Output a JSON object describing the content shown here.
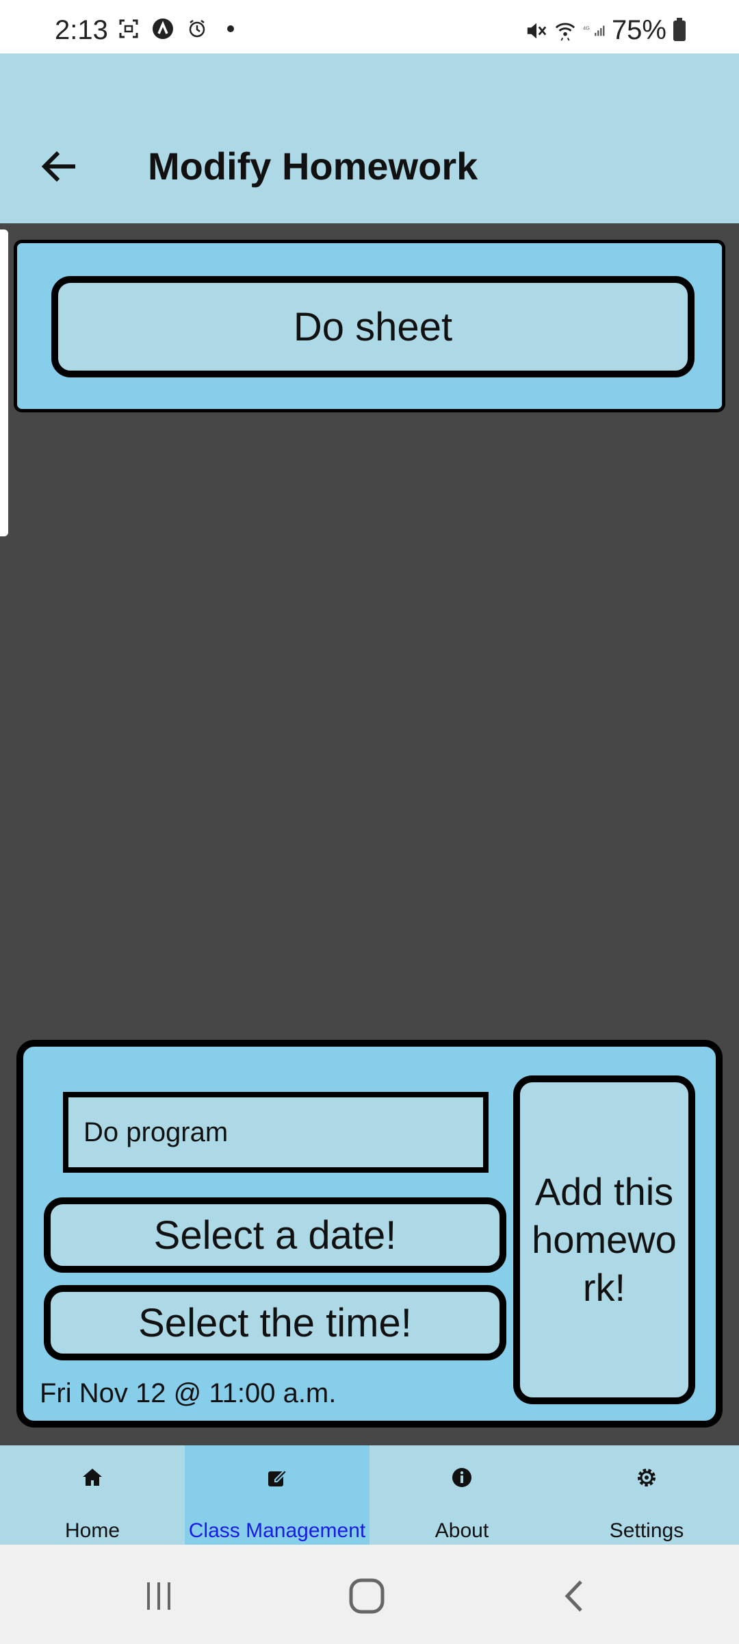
{
  "status_bar": {
    "time": "2:13",
    "battery": "75%",
    "icons": [
      "screenshot-icon",
      "app-notification-icon",
      "alarm-icon",
      "mute-icon",
      "wifi-icon",
      "4g-signal-icon",
      "battery-icon"
    ]
  },
  "header": {
    "title": "Modify Homework",
    "back_icon": "arrow-left-icon"
  },
  "homework_list": {
    "items": [
      {
        "label": "Do sheet"
      }
    ]
  },
  "form": {
    "input_value": "Do program",
    "select_date_label": "Select a date!",
    "select_time_label": "Select the time!",
    "selected_datetime": "Fri Nov 12 @ 11:00 a.m.",
    "add_button_label": "Add this homework!"
  },
  "tabs": [
    {
      "label": "Home",
      "icon": "home-icon",
      "active": false
    },
    {
      "label": "Class Management",
      "icon": "edit-icon",
      "active": true
    },
    {
      "label": "About",
      "icon": "info-icon",
      "active": false
    },
    {
      "label": "Settings",
      "icon": "gear-icon",
      "active": false
    }
  ],
  "colors": {
    "header_bg": "#add8e6",
    "card_bg": "#87ceeb",
    "button_bg": "#add8e6",
    "page_bg": "#474747",
    "active_tab_text": "#1a1ae6"
  }
}
